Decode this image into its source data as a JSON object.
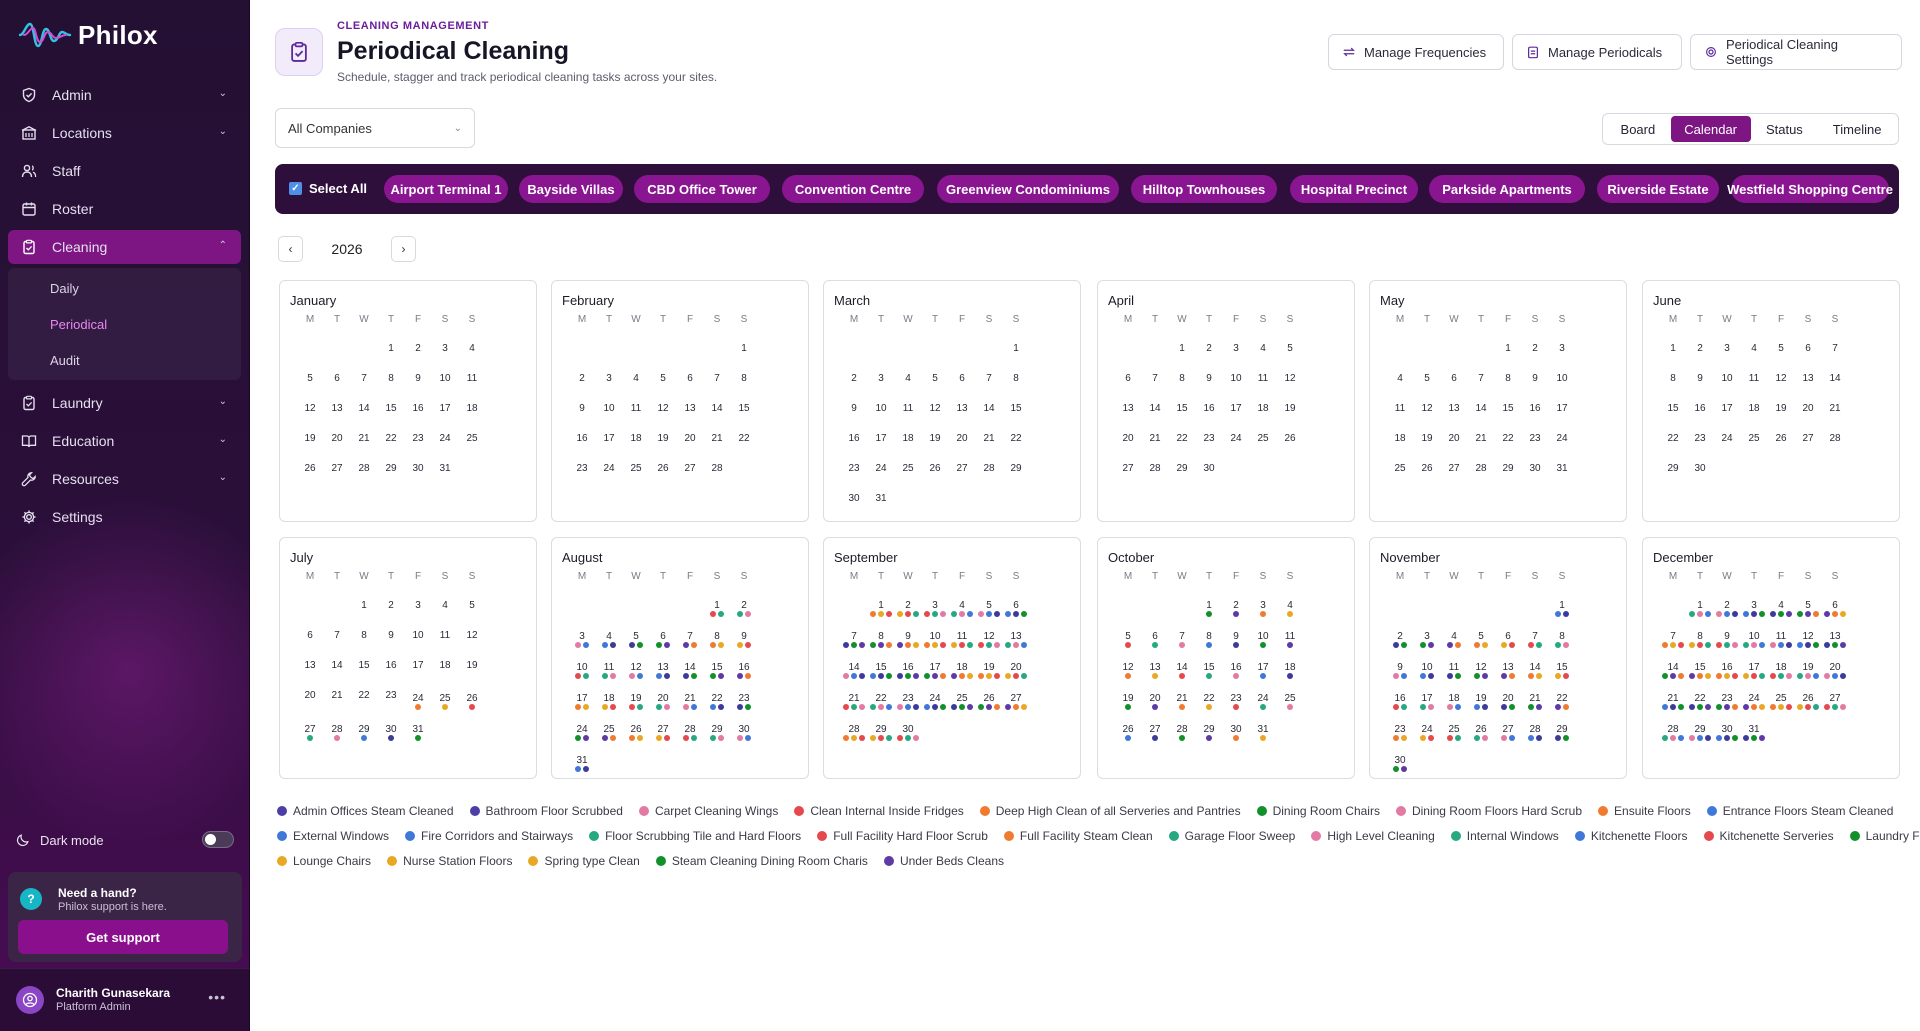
{
  "app": {
    "name": "Philox"
  },
  "nav": {
    "items": [
      {
        "label": "Admin",
        "icon": "shield-icon",
        "chevron": "down"
      },
      {
        "label": "Locations",
        "icon": "building-icon",
        "chevron": "down"
      },
      {
        "label": "Staff",
        "icon": "users-icon",
        "chevron": ""
      },
      {
        "label": "Roster",
        "icon": "calendar-icon",
        "chevron": ""
      },
      {
        "label": "Cleaning",
        "icon": "clipboard-icon",
        "chevron": "up",
        "active": true
      },
      {
        "label": "Laundry",
        "icon": "clipboard-icon",
        "chevron": "down"
      },
      {
        "label": "Education",
        "icon": "book-icon",
        "chevron": "down"
      },
      {
        "label": "Resources",
        "icon": "wrench-icon",
        "chevron": "down"
      },
      {
        "label": "Settings",
        "icon": "gear-icon",
        "chevron": ""
      }
    ],
    "cleaning_sub": [
      {
        "label": "Daily"
      },
      {
        "label": "Periodical",
        "active": true
      },
      {
        "label": "Audit"
      }
    ]
  },
  "dark_mode": {
    "label": "Dark mode",
    "enabled": false
  },
  "help": {
    "title": "Need a hand?",
    "subtitle": "Philox support is here.",
    "button": "Get support"
  },
  "user": {
    "name": "Charith Gunasekara",
    "role": "Platform Admin"
  },
  "header": {
    "eyebrow": "CLEANING MANAGEMENT",
    "title": "Periodical Cleaning",
    "subtitle": "Schedule, stagger and track periodical cleaning tasks across your sites."
  },
  "toolbar": {
    "manage_frequencies": "Manage Frequencies",
    "manage_periodicals": "Manage Periodicals",
    "settings": "Periodical Cleaning Settings"
  },
  "company_select": {
    "value": "All Companies"
  },
  "views": {
    "items": [
      "Board",
      "Calendar",
      "Status",
      "Timeline"
    ],
    "active": "Calendar"
  },
  "filters": {
    "select_all_label": "Select All",
    "select_all_checked": true,
    "sites": [
      "Airport Terminal 1",
      "Bayside Villas",
      "CBD Office Tower",
      "Convention Centre",
      "Greenview Condominiums",
      "Hilltop Townhouses",
      "Hospital Precinct",
      "Parkside Apartments",
      "Riverside Estate",
      "Westfield Shopping Centre"
    ]
  },
  "calendar": {
    "year": "2026",
    "prev": "‹",
    "next": "›",
    "weekdays": [
      "M",
      "T",
      "W",
      "T",
      "F",
      "S",
      "S"
    ],
    "months": [
      "January",
      "February",
      "March",
      "April",
      "May",
      "June",
      "July",
      "August",
      "September",
      "October",
      "November",
      "December"
    ]
  },
  "colors": {
    "accent": "#7d1683",
    "tasks": {
      "navy": "#3d3a9c",
      "pink": "#e27aa3",
      "red": "#e5484d",
      "orange": "#f07a30",
      "green": "#12902a",
      "blue": "#3f78d8",
      "teal": "#26a881",
      "yellow": "#e9a824",
      "purple": "#5d3aa5"
    }
  },
  "legend": [
    {
      "label": "Admin Offices Steam Cleaned",
      "color": "#4b3fa5"
    },
    {
      "label": "Bathroom Floor Scrubbed",
      "color": "#4b3fa5"
    },
    {
      "label": "Carpet Cleaning Wings",
      "color": "#e27aa3"
    },
    {
      "label": "Clean Internal Inside Fridges",
      "color": "#e5484d"
    },
    {
      "label": "Deep High Clean of all Serveries and Pantries",
      "color": "#f07a30"
    },
    {
      "label": "Dining Room Chairs",
      "color": "#12902a"
    },
    {
      "label": "Dining Room Floors Hard Scrub",
      "color": "#e27aa3"
    },
    {
      "label": "Ensuite Floors",
      "color": "#f07a30"
    },
    {
      "label": "Entrance Floors Steam Cleaned",
      "color": "#3f78d8"
    },
    {
      "label": "External Windows",
      "color": "#3f78d8"
    },
    {
      "label": "Fire Corridors and Stairways",
      "color": "#3f78d8"
    },
    {
      "label": "Floor Scrubbing Tile and Hard Floors",
      "color": "#26a881"
    },
    {
      "label": "Full Facility Hard Floor Scrub",
      "color": "#e5484d"
    },
    {
      "label": "Full Facility Steam Clean",
      "color": "#f07a30"
    },
    {
      "label": "Garage Floor Sweep",
      "color": "#26a881"
    },
    {
      "label": "High Level Cleaning",
      "color": "#e27aa3"
    },
    {
      "label": "Internal Windows",
      "color": "#26a881"
    },
    {
      "label": "Kitchenette Floors",
      "color": "#3f78d8"
    },
    {
      "label": "Kitchenette Serveries",
      "color": "#e5484d"
    },
    {
      "label": "Laundry Floors",
      "color": "#12902a"
    },
    {
      "label": "Lounge Chairs",
      "color": "#e9a824"
    },
    {
      "label": "Nurse Station Floors",
      "color": "#e9a824"
    },
    {
      "label": "Spring type Clean",
      "color": "#e9a824"
    },
    {
      "label": "Steam Cleaning Dining Room Charis",
      "color": "#12902a"
    },
    {
      "label": "Under Beds Cleans",
      "color": "#5d3aa5"
    }
  ]
}
